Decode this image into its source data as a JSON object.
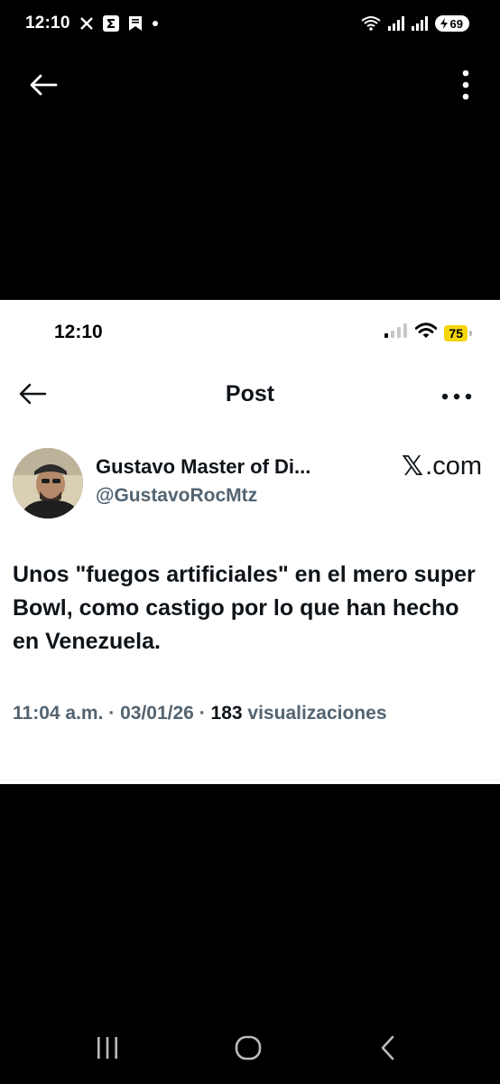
{
  "android_status": {
    "time": "12:10",
    "battery": "69",
    "icons": [
      "x-logo-icon",
      "sigma-notification-icon",
      "bookmark-notification-icon",
      "dot-icon",
      "wifi-icon",
      "signal-icon",
      "signal-icon-2",
      "battery-icon"
    ]
  },
  "viewer": {
    "back_icon": "arrow-left-icon",
    "more_icon": "more-vertical-icon"
  },
  "ios_status": {
    "time": "12:10",
    "battery": "75"
  },
  "post_header": {
    "title": "Post"
  },
  "author": {
    "name": "Gustavo Master of Di...",
    "handle": "@GustavoRocMtz",
    "source_logo": "𝕏",
    "source_text": ".com"
  },
  "tweet": {
    "text": "Unos \"fuegos artificiales\" en el mero super Bowl, como castigo por lo que han hecho en Venezuela."
  },
  "meta": {
    "time": "11:04 a.m.",
    "separator": "·",
    "date": "03/01/26",
    "views_count": "183",
    "views_label": "visualizaciones"
  },
  "colors": {
    "text_primary": "#0f1419",
    "text_secondary": "#536471",
    "ios_battery": "#f5d60a"
  }
}
